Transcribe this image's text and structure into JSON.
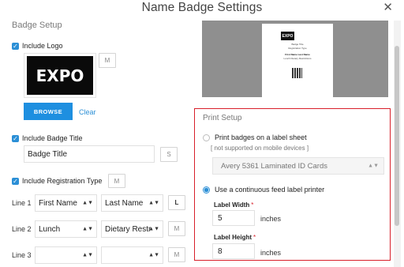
{
  "dialog": {
    "title": "Name Badge Settings",
    "close_glyph": "✕"
  },
  "badge_setup": {
    "section_title": "Badge Setup",
    "include_logo": {
      "label": "Include Logo",
      "checked": true
    },
    "logo_text": "EXPO",
    "logo_mode_button": "M",
    "browse_label": "BROWSE",
    "clear_label": "Clear",
    "include_badge_title": {
      "label": "Include Badge Title",
      "checked": true
    },
    "badge_title_value": "Badge Title",
    "badge_title_size_button": "S",
    "include_registration_type": {
      "label": "Include Registration Type",
      "checked": true
    },
    "registration_type_size_button": "M",
    "lines": [
      {
        "label": "Line 1",
        "field_a": "First Name",
        "field_b": "Last Name",
        "size_button": "L"
      },
      {
        "label": "Line 2",
        "field_a": "Lunch",
        "field_b": "Dietary Restr",
        "size_button": "M"
      },
      {
        "label": "Line 3",
        "field_a": "",
        "field_b": "",
        "size_button": "M"
      }
    ]
  },
  "preview": {
    "logo_text": "EXPO",
    "lines": [
      "Badge Title",
      "Registration Type",
      "First Name Last Name",
      "Lunch Dietary Restrictions"
    ]
  },
  "print_setup": {
    "section_title": "Print Setup",
    "option_sheet": {
      "label": "Print badges on a label sheet",
      "selected": false
    },
    "sheet_note": "[ not supported on mobile devices ]",
    "sheet_type_value": "Avery 5361 Laminated ID Cards",
    "option_continuous": {
      "label": "Use a continuous feed label printer",
      "selected": true
    },
    "label_width": {
      "label": "Label Width",
      "required_mark": "*",
      "value": "5",
      "unit": "inches"
    },
    "label_height": {
      "label": "Label Height",
      "required_mark": "*",
      "value": "8",
      "unit": "inches"
    }
  },
  "colors": {
    "accent": "#2b8fd6",
    "highlight_border": "#d81f2a",
    "browse_button": "#1e8fe0"
  }
}
